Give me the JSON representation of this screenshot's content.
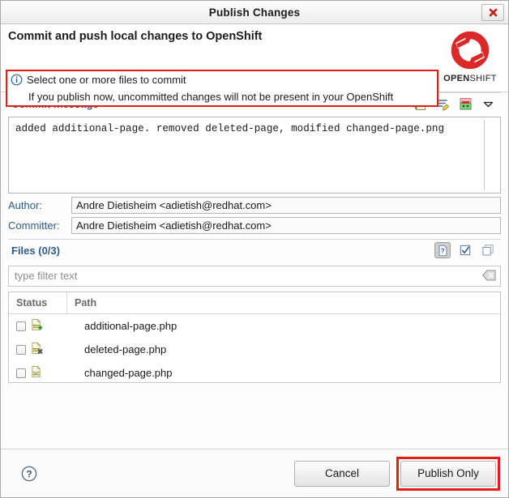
{
  "window": {
    "title": "Publish Changes",
    "close_icon": "close-icon"
  },
  "header": {
    "title": "Commit and push local changes to OpenShift",
    "info_icon": "info-icon",
    "message_line1": "Select one or more files to commit",
    "message_line2": "If you publish now, uncommitted changes will not be present in your OpenShift",
    "highlight_color": "#e41e14",
    "logo": {
      "name": "openshift-logo",
      "word_bold": "OPEN",
      "word_thin": "SHIFT",
      "color": "#db2828"
    }
  },
  "commit": {
    "section_title": "Commit message",
    "message": "added additional-page. removed deleted-page, modified changed-page.png",
    "tools": [
      {
        "name": "add-signed-off-by-icon"
      },
      {
        "name": "amend-previous-commit-icon"
      },
      {
        "name": "add-change-id-icon"
      },
      {
        "name": "chevron-down-icon"
      }
    ]
  },
  "author": {
    "label": "Author:",
    "value": "Andre Dietisheim <adietish@redhat.com>"
  },
  "committer": {
    "label": "Committer:",
    "value": "Andre Dietisheim <adietish@redhat.com>"
  },
  "files": {
    "section_title": "Files (0/3)",
    "tools": [
      {
        "name": "show-untracked-files-icon",
        "pressed": true
      },
      {
        "name": "select-all-icon",
        "pressed": false
      },
      {
        "name": "deselect-all-icon",
        "pressed": false
      }
    ],
    "filter_placeholder": "type filter text",
    "filter_value": "",
    "clear_icon": "clear-filter-icon",
    "columns": [
      "Status",
      "Path"
    ],
    "rows": [
      {
        "status_icon": "html-file-added-icon",
        "checked": false,
        "path": "additional-page.php"
      },
      {
        "status_icon": "html-file-removed-icon",
        "checked": false,
        "path": "deleted-page.php"
      },
      {
        "status_icon": "html-file-modified-icon",
        "checked": false,
        "path": "changed-page.php"
      }
    ]
  },
  "footer": {
    "help_icon": "help-icon",
    "cancel_label": "Cancel",
    "publish_label": "Publish Only"
  }
}
